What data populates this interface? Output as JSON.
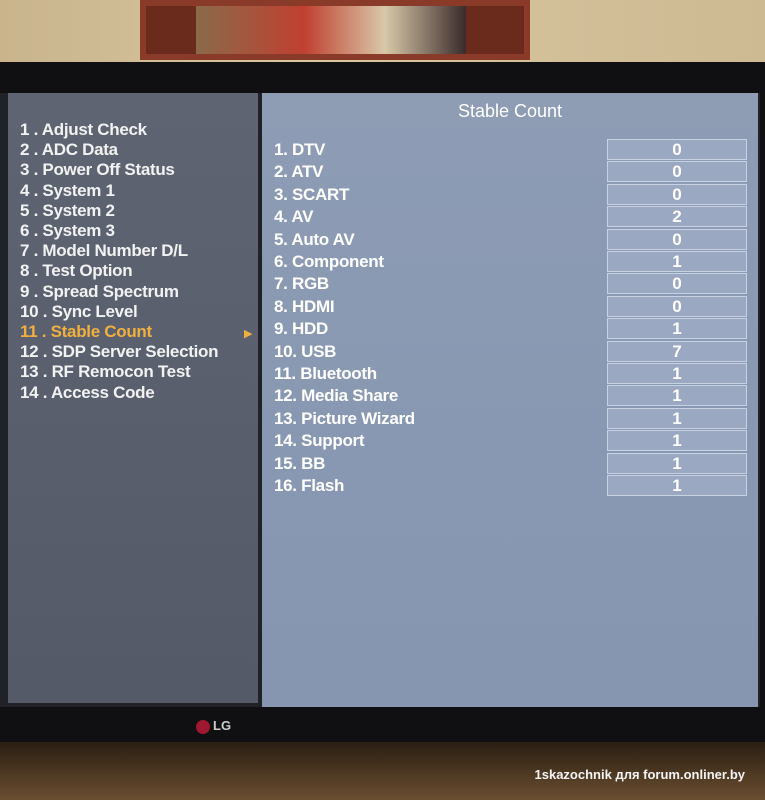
{
  "menu": {
    "items": [
      {
        "label": "1 . Adjust Check"
      },
      {
        "label": "2 . ADC Data"
      },
      {
        "label": "3 . Power Off Status"
      },
      {
        "label": "4 . System 1"
      },
      {
        "label": "5 . System 2"
      },
      {
        "label": "6 . System 3"
      },
      {
        "label": "7 . Model Number D/L"
      },
      {
        "label": "8 . Test Option"
      },
      {
        "label": "9 . Spread Spectrum"
      },
      {
        "label": "10 . Sync Level"
      },
      {
        "label": "11 . Stable Count"
      },
      {
        "label": "12 . SDP Server Selection"
      },
      {
        "label": "13 . RF Remocon Test"
      },
      {
        "label": "14 . Access Code"
      }
    ],
    "selected_index": 10,
    "selected_color": "#f0b040",
    "arrow": "▶"
  },
  "panel": {
    "title": "Stable Count",
    "rows": [
      {
        "label": "1. DTV",
        "value": "0"
      },
      {
        "label": "2. ATV",
        "value": "0"
      },
      {
        "label": "3. SCART",
        "value": "0"
      },
      {
        "label": "4. AV",
        "value": "2"
      },
      {
        "label": "5. Auto AV",
        "value": "0"
      },
      {
        "label": "6. Component",
        "value": "1"
      },
      {
        "label": "7. RGB",
        "value": "0"
      },
      {
        "label": "8. HDMI",
        "value": "0"
      },
      {
        "label": "9. HDD",
        "value": "1"
      },
      {
        "label": "10. USB",
        "value": "7"
      },
      {
        "label": "11. Bluetooth",
        "value": "1"
      },
      {
        "label": "12. Media Share",
        "value": "1"
      },
      {
        "label": "13. Picture Wizard",
        "value": "1"
      },
      {
        "label": "14. Support",
        "value": "1"
      },
      {
        "label": "15. BB",
        "value": "1"
      },
      {
        "label": "16. Flash",
        "value": "1"
      }
    ]
  },
  "brand": "LG",
  "watermark": "1skazochnik для forum.onliner.by"
}
